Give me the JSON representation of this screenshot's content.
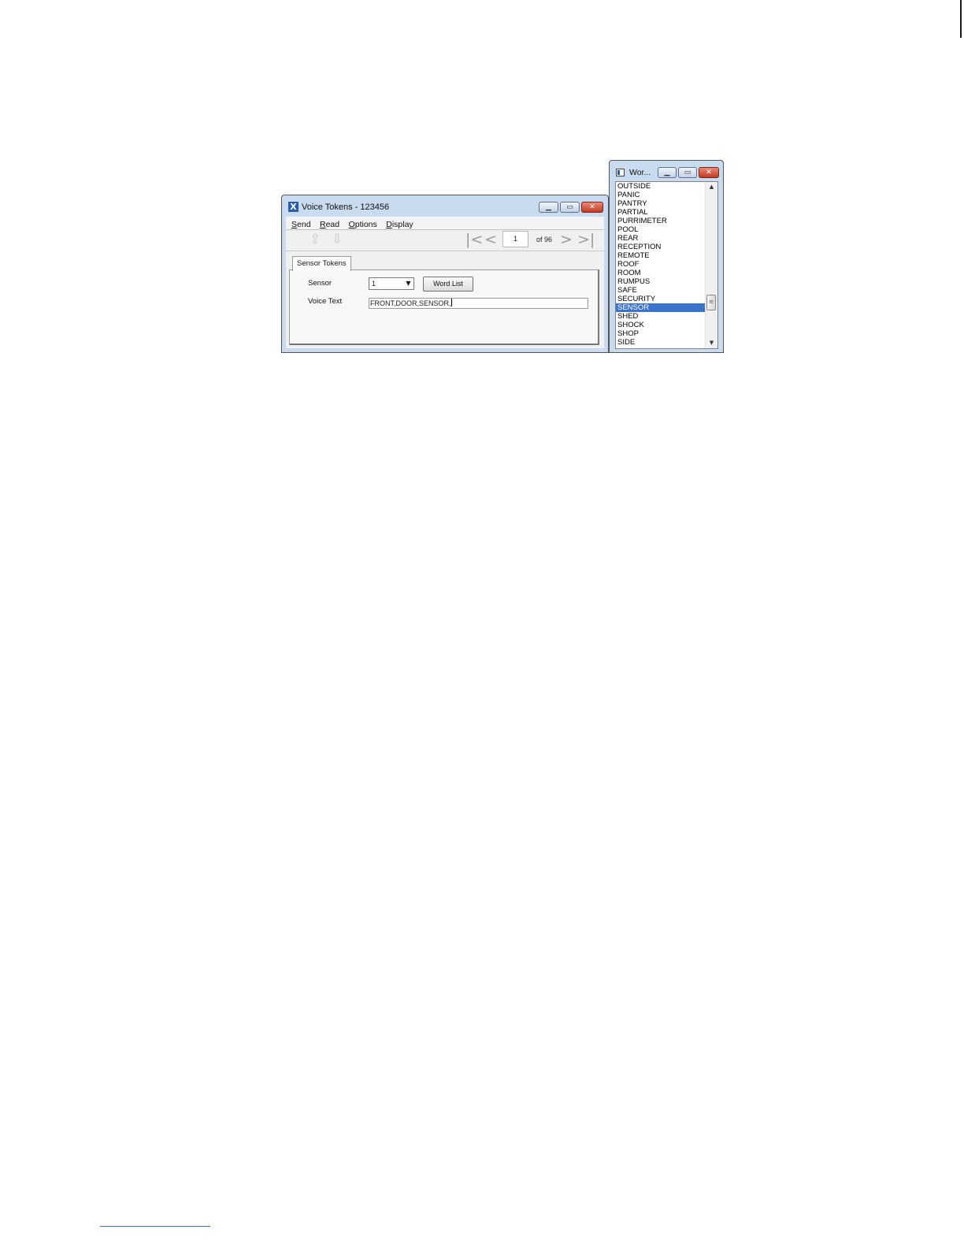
{
  "voice_window": {
    "title": "Voice Tokens - 123456",
    "app_icon": "X",
    "caption": {
      "minimize": "▁",
      "maximize": "▭",
      "close": "✕"
    },
    "menus": [
      "Send",
      "Read",
      "Options",
      "Display"
    ],
    "toolbar": {
      "send_icon": "⇧",
      "read_icon": "⇩",
      "nav_first": "|<",
      "nav_prev": "<",
      "nav_next": ">",
      "nav_last": ">|",
      "page": "1",
      "of_label": "of 96"
    },
    "tab": "Sensor Tokens",
    "sensor_label": "Sensor",
    "sensor_value": "1",
    "word_list_button": "Word List",
    "voice_text_label": "Voice Text",
    "voice_text_value": "FRONT,DOOR,SENSOR,"
  },
  "word_window": {
    "title": "Wor...",
    "caption": {
      "minimize": "▁",
      "maximize": "▭",
      "close": "✕"
    },
    "items": [
      "OUTSIDE",
      "PANIC",
      "PANTRY",
      "PARTIAL",
      "PURRIMETER",
      "POOL",
      "REAR",
      "RECEPTION",
      "REMOTE",
      "ROOF",
      "ROOM",
      "RUMPUS",
      "SAFE",
      "SECURITY",
      "SENSOR",
      "SHED",
      "SHOCK",
      "SHOP",
      "SIDE"
    ],
    "selected": "SENSOR",
    "scroll_up": "▲",
    "scroll_down": "▼",
    "thumb_grip": "≡"
  },
  "colors": {
    "window_frame": "#c9dbef",
    "selection": "#3b73cc",
    "close_button": "#c33a21"
  }
}
